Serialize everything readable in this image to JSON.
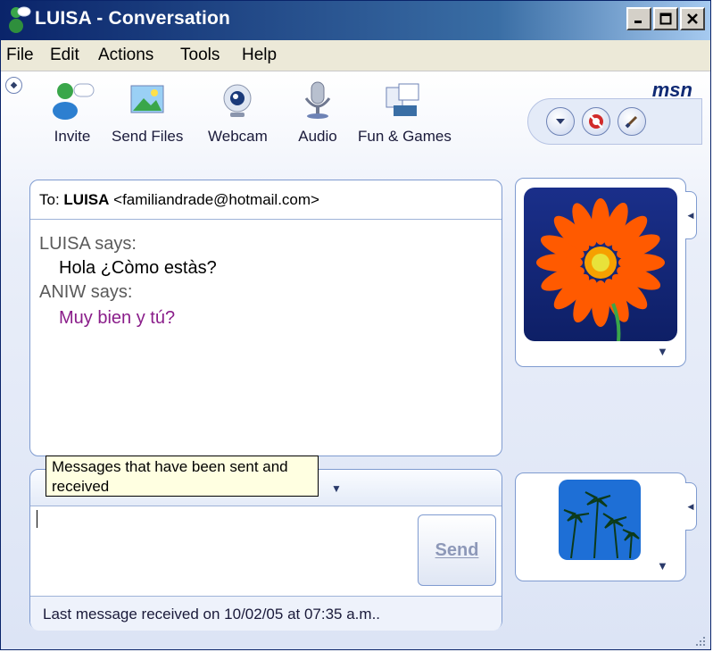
{
  "window": {
    "title": "LUISA - Conversation"
  },
  "menu": [
    "File",
    "Edit",
    "Actions",
    "Tools",
    "Help"
  ],
  "toolbar": {
    "items": [
      {
        "label": "Invite",
        "icon": "invite-icon"
      },
      {
        "label": "Send Files",
        "icon": "send-files-icon"
      },
      {
        "label": "Webcam",
        "icon": "webcam-icon"
      },
      {
        "label": "Audio",
        "icon": "audio-icon"
      },
      {
        "label": "Fun & Games",
        "icon": "fun-games-icon"
      }
    ],
    "brand": "msn"
  },
  "conversation": {
    "to_prefix": "To:",
    "contact_name": "LUISA",
    "contact_email": "<familiandrade@hotmail.com>",
    "messages": [
      {
        "sender_line": "LUISA says:",
        "text": "Hola ¿Còmo estàs?"
      },
      {
        "sender_line": "ANIW says:",
        "text": "Muy bien y tú?"
      }
    ],
    "colors": {
      "incoming": "#000000",
      "outgoing": "#8a1d8a",
      "sender": "#5a5a5a"
    }
  },
  "tooltip": {
    "text": "Messages that have been sent and received"
  },
  "input": {
    "value": "",
    "send_label": "Send"
  },
  "status": {
    "text": "Last message received on 10/02/05 at 07:35 a.m.."
  }
}
